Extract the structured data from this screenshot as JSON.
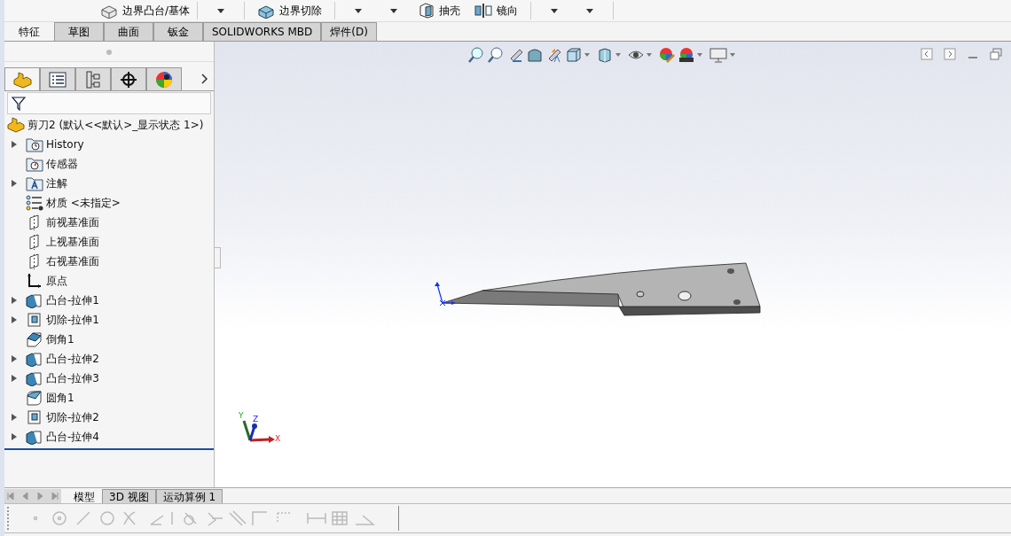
{
  "toolbar": {
    "items": [
      {
        "kind": "boundary-boss",
        "label": "边界凸台/基体"
      },
      {
        "kind": "divider"
      },
      {
        "kind": "caret"
      },
      {
        "kind": "divider"
      },
      {
        "kind": "boundary-cut",
        "label": "边界切除"
      },
      {
        "kind": "divider"
      },
      {
        "kind": "caret"
      },
      {
        "kind": "caret"
      },
      {
        "kind": "shell",
        "label": "抽壳"
      },
      {
        "kind": "mirror",
        "label": "镜向"
      },
      {
        "kind": "divider"
      },
      {
        "kind": "caret"
      },
      {
        "kind": "caret"
      },
      {
        "kind": "divider"
      }
    ]
  },
  "tabs": [
    {
      "label": "特征",
      "selected": true
    },
    {
      "label": "草图",
      "selected": false
    },
    {
      "label": "曲面",
      "selected": false
    },
    {
      "label": "钣金",
      "selected": false
    },
    {
      "label": "SOLIDWORKS MBD",
      "selected": false
    },
    {
      "label": "焊件(D)",
      "selected": false
    }
  ],
  "panel_tabs": [
    {
      "kind": "feature-tree",
      "selected": true
    },
    {
      "kind": "property",
      "selected": false
    },
    {
      "kind": "config",
      "selected": false
    },
    {
      "kind": "dimxpert",
      "selected": false
    },
    {
      "kind": "display",
      "selected": false
    }
  ],
  "tree": {
    "label": "剪刀2  (默认<<默认>_显示状态 1>)",
    "children": [
      {
        "label": "History",
        "kind": "history",
        "expanded": false
      },
      {
        "label": "传感器",
        "kind": "sensor"
      },
      {
        "label": "注解",
        "kind": "annotation",
        "expanded": false
      },
      {
        "label": "材质 <未指定>",
        "kind": "material"
      },
      {
        "label": "前视基准面",
        "kind": "plane"
      },
      {
        "label": "上视基准面",
        "kind": "plane"
      },
      {
        "label": "右视基准面",
        "kind": "plane"
      },
      {
        "label": "原点",
        "kind": "origin"
      },
      {
        "label": "凸台-拉伸1",
        "kind": "boss",
        "expanded": false
      },
      {
        "label": "切除-拉伸1",
        "kind": "cut",
        "expanded": false
      },
      {
        "label": "倒角1",
        "kind": "chamfer"
      },
      {
        "label": "凸台-拉伸2",
        "kind": "boss",
        "expanded": false
      },
      {
        "label": "凸台-拉伸3",
        "kind": "boss",
        "expanded": false
      },
      {
        "label": "圆角1",
        "kind": "fillet"
      },
      {
        "label": "切除-拉伸2",
        "kind": "cut",
        "expanded": false
      },
      {
        "label": "凸台-拉伸4",
        "kind": "boss",
        "expanded": false
      }
    ]
  },
  "triad": {
    "x": "X",
    "y": "Y",
    "z": "Z"
  },
  "bottom_tabs": [
    {
      "label": "模型",
      "selected": true
    },
    {
      "label": "3D 视图",
      "selected": false
    },
    {
      "label": "运动算例 1",
      "selected": false
    }
  ]
}
